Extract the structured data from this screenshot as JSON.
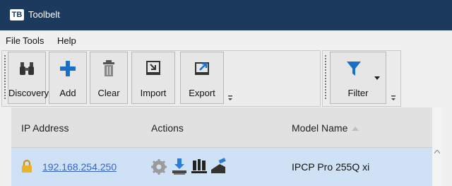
{
  "window": {
    "logo_text": "TB",
    "title": "Toolbelt"
  },
  "menu": [
    "File",
    "Tools",
    "Help"
  ],
  "toolbar": {
    "discovery": "Discovery",
    "add": "Add",
    "clear": "Clear",
    "import": "Import",
    "export": "Export",
    "filter": "Filter"
  },
  "table": {
    "headers": {
      "ip": "IP Address",
      "actions": "Actions",
      "model": "Model Name"
    },
    "sort_column": "Model Name",
    "rows": [
      {
        "ip": "192.168.254.250",
        "model": "IPCP Pro 255Q xi",
        "locked": true,
        "actions": [
          "gear-icon",
          "download-icon",
          "network-icon",
          "erase-icon"
        ]
      }
    ]
  },
  "colors": {
    "titlebar": "#1c3a5e",
    "add_icon": "#1a6fc9",
    "filter_icon": "#1a6fc9",
    "link": "#3b63c4",
    "selected_row": "#cfe2f5"
  }
}
